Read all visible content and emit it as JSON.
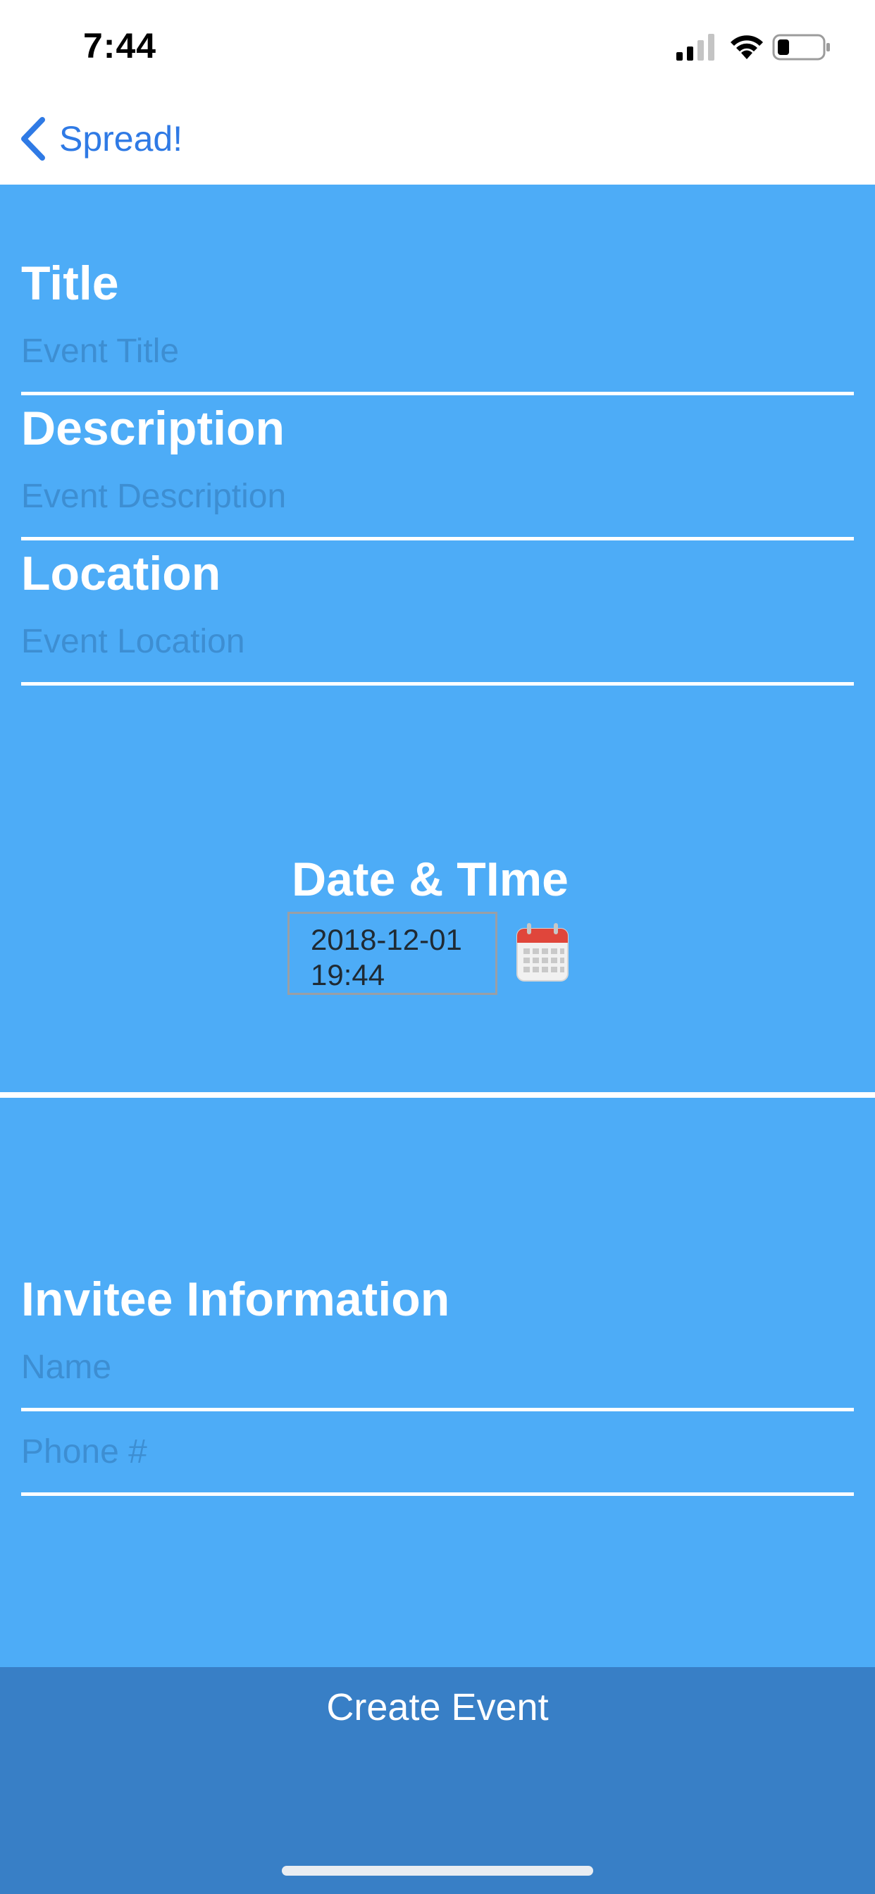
{
  "status_bar": {
    "time": "7:44",
    "icons": [
      "cellular-signal-icon",
      "wifi-icon",
      "battery-icon"
    ]
  },
  "nav": {
    "back_label": "Spread!",
    "back_icon": "chevron-left-icon",
    "accent_color": "#2f7ae5"
  },
  "form": {
    "title": {
      "label": "Title",
      "placeholder": "Event Title",
      "value": ""
    },
    "description": {
      "label": "Description",
      "placeholder": "Event Description",
      "value": ""
    },
    "location": {
      "label": "Location",
      "placeholder": "Event Location",
      "value": ""
    },
    "datetime": {
      "label": "Date & TIme",
      "date": "2018-12-01",
      "time": "19:44",
      "icon": "calendar-icon"
    },
    "invitee": {
      "heading": "Invitee Information",
      "name": {
        "placeholder": "Name",
        "value": ""
      },
      "phone": {
        "placeholder": "Phone #",
        "value": ""
      }
    }
  },
  "footer": {
    "create_label": "Create Event"
  },
  "colors": {
    "background": "#4dacf7",
    "button": "#387fc6",
    "placeholder": "#3d8ed2"
  }
}
